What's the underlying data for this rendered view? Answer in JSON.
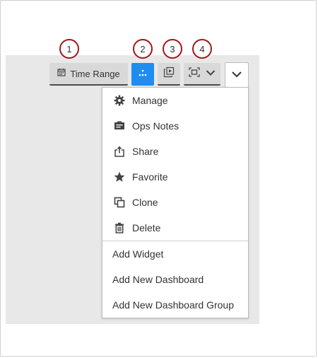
{
  "callouts": [
    "1",
    "2",
    "3",
    "4"
  ],
  "toolbar": {
    "time_range_label": "Time Range"
  },
  "menu": {
    "items": [
      {
        "label": "Manage",
        "icon": "gear-icon"
      },
      {
        "label": "Ops Notes",
        "icon": "notes-icon"
      },
      {
        "label": "Share",
        "icon": "share-icon"
      },
      {
        "label": "Favorite",
        "icon": "star-icon"
      },
      {
        "label": "Clone",
        "icon": "clone-icon"
      },
      {
        "label": "Delete",
        "icon": "trash-icon"
      }
    ],
    "actions": [
      {
        "label": "Add Widget"
      },
      {
        "label": "Add New Dashboard"
      },
      {
        "label": "Add New Dashboard Group"
      }
    ]
  },
  "colors": {
    "accent_blue": "#1f8cf0",
    "callout_red": "#a3161c",
    "panel_grey": "#e8e8e8"
  }
}
